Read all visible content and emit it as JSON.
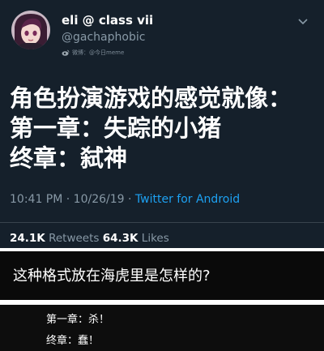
{
  "tweet": {
    "display_name": "eli @ class vii",
    "handle": "@gachaphobic",
    "watermark": "微博：@今日meme",
    "lines": [
      "角色扮演游戏的感觉就像：",
      "第一章：失踪的小猪",
      "终章：弑神"
    ],
    "time": "10:41 PM · 10/26/19 · ",
    "source": "Twitter for Android",
    "retweets_count": "24.1K",
    "retweets_label": " Retweets  ",
    "likes_count": "64.3K",
    "likes_label": " Likes",
    "icons": {
      "avatar": "avatar-illustration",
      "chevron": "chevron-down-icon"
    }
  },
  "question": "这种格式放在海虎里是怎样的?",
  "answer": {
    "line1": "第一章：杀！",
    "line2": "终章：蠢！"
  },
  "colors": {
    "tweet_bg": "#15202b",
    "secondary_text": "#8899a6",
    "link": "#1da1f2",
    "caption_bg": "#0a0a0a"
  }
}
